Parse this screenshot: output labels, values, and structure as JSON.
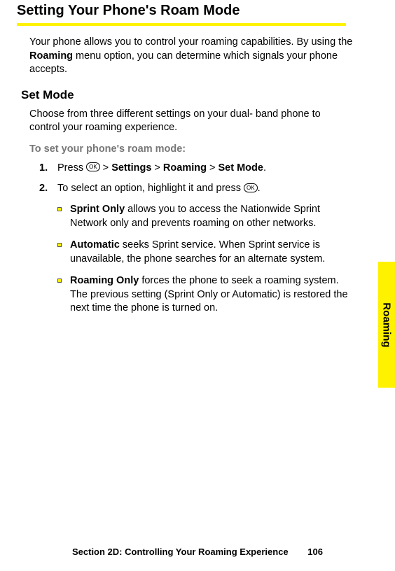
{
  "title": "Setting Your Phone's Roam Mode",
  "intro_before": "Your phone allows you to control your roaming capabilities. By using the ",
  "intro_bold": "Roaming",
  "intro_after": " menu option, you can determine which signals your phone accepts.",
  "subheading": "Set Mode",
  "subtext": "Choose from three different settings on your dual- band phone to control your roaming experience.",
  "instruction_title": "To set your phone's roam mode:",
  "step1_num": "1.",
  "step1_press": "Press ",
  "ok_label": "OK",
  "step1_gt": " > ",
  "step1_settings": "Settings",
  "step1_roaming": "Roaming",
  "step1_setmode": "Set Mode",
  "step1_period": ".",
  "step2_num": "2.",
  "step2_text_before": "To select an option, highlight it and press ",
  "step2_text_after": ".",
  "bullets": [
    {
      "bold": "Sprint Only",
      "rest": " allows you to access the Nationwide Sprint Network only and prevents roaming on other networks."
    },
    {
      "bold": "Automatic",
      "rest": " seeks Sprint service. When Sprint service is unavailable, the phone searches for an alternate system."
    },
    {
      "bold": "Roaming Only",
      "rest": " forces the phone to seek a roaming system. The previous setting (Sprint Only or Automatic) is restored the next time the phone is turned on."
    }
  ],
  "tab": "Roaming",
  "footer_section": "Section 2D: Controlling Your Roaming Experience",
  "footer_page": "106"
}
